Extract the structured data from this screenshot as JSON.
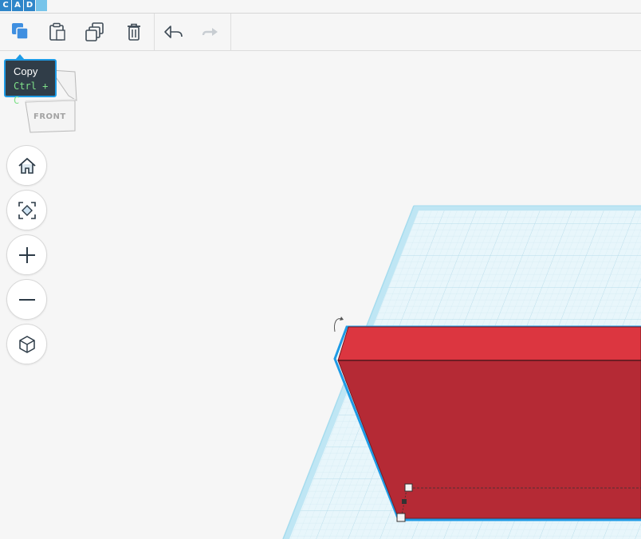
{
  "app": {
    "logo_letters": [
      "C",
      "A",
      "D",
      ""
    ]
  },
  "toolbar": {
    "buttons": [
      {
        "name": "copy",
        "icon": "copy-icon"
      },
      {
        "name": "paste",
        "icon": "paste-icon"
      },
      {
        "name": "duplicate",
        "icon": "duplicate-icon"
      },
      {
        "name": "delete",
        "icon": "trash-icon"
      },
      {
        "name": "undo",
        "icon": "undo-icon"
      },
      {
        "name": "redo",
        "icon": "redo-icon",
        "disabled": true
      }
    ]
  },
  "tooltip": {
    "title": "Copy",
    "shortcut": "Ctrl + C"
  },
  "viewcube": {
    "face_label": "FRONT"
  },
  "view_controls": [
    {
      "name": "home-view",
      "icon": "home-icon"
    },
    {
      "name": "fit-view",
      "icon": "fit-all-icon"
    },
    {
      "name": "zoom-in",
      "icon": "plus-icon"
    },
    {
      "name": "zoom-out",
      "icon": "minus-icon"
    },
    {
      "name": "ortho-view",
      "icon": "cube-icon"
    }
  ],
  "colors": {
    "accent": "#1e9be5",
    "shape_top": "#dc3640",
    "shape_front": "#b52a35",
    "grid_fill": "#e8f6fb",
    "grid_edge": "#a6dcee"
  }
}
